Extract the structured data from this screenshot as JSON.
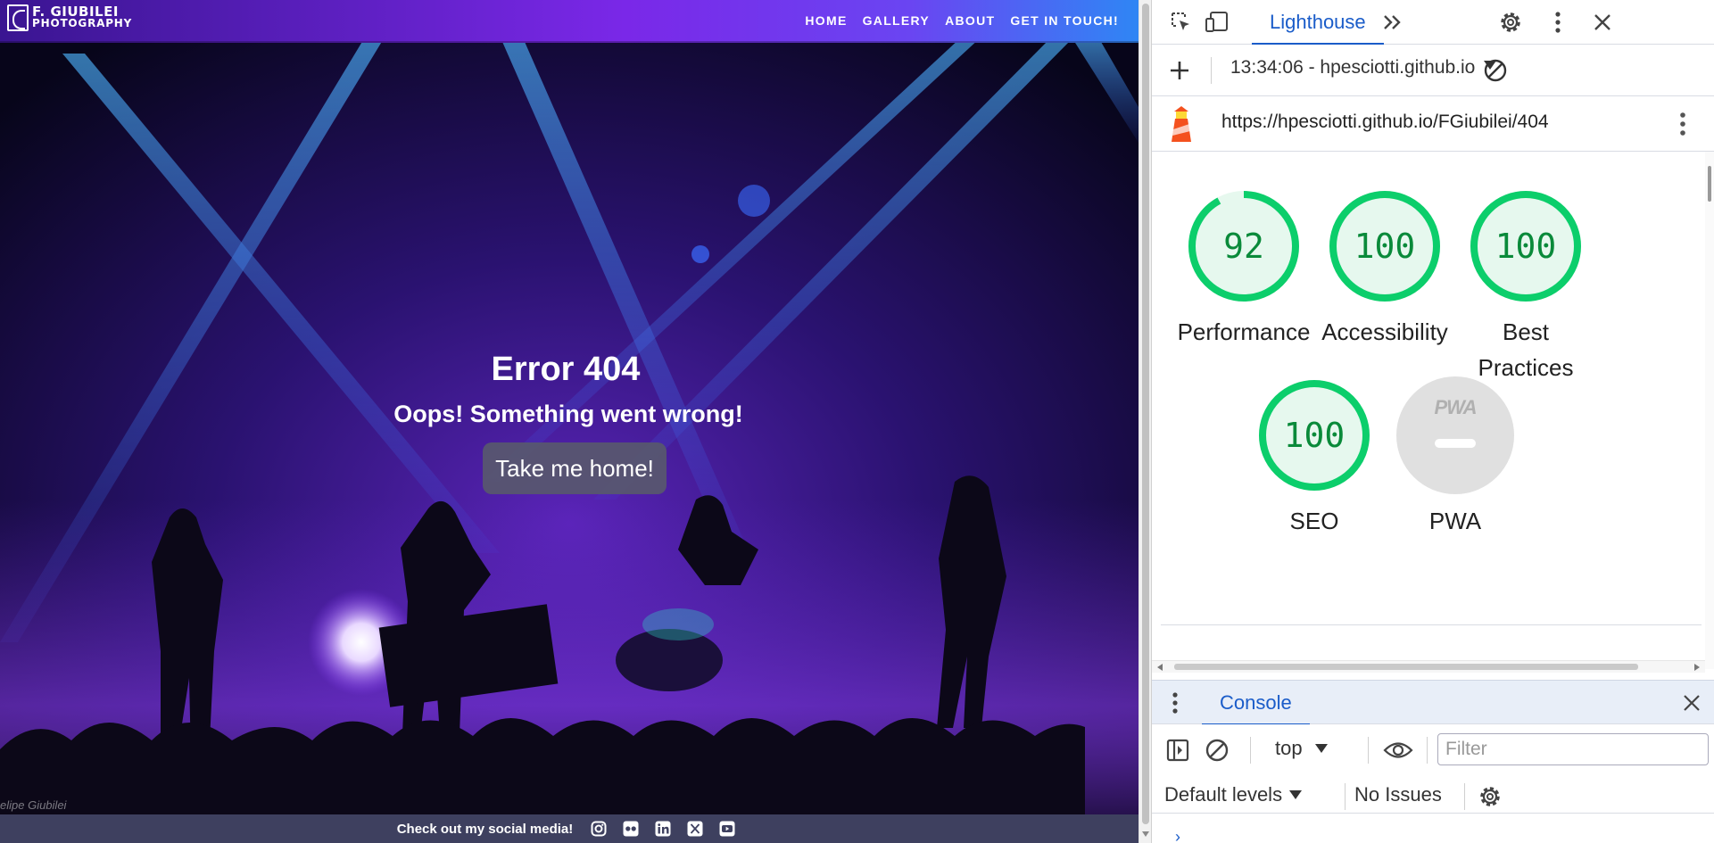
{
  "site": {
    "logo": {
      "line1": "F. GIUBILEI",
      "line2": "PHOTOGRAPHY"
    },
    "nav": [
      "HOME",
      "GALLERY",
      "ABOUT",
      "GET IN TOUCH!"
    ],
    "hero": {
      "title": "Error 404",
      "subtitle": "Oops! Something went wrong!",
      "button": "Take me home!"
    },
    "watermark": "elipe Giubilei",
    "footer": {
      "text": "Check out my social media!",
      "icons": [
        "instagram-icon",
        "flickr-icon",
        "linkedin-icon",
        "x-icon",
        "youtube-icon"
      ]
    }
  },
  "devtools": {
    "active_tab": "Lighthouse",
    "session": "13:34:06 - hpesciotti.github.io",
    "url": "https://hpesciotti.github.io/FGiubilei/404",
    "scores": [
      {
        "label": "Performance",
        "value": "92",
        "fraction": 0.92
      },
      {
        "label": "Accessibility",
        "value": "100",
        "fraction": 1.0
      },
      {
        "label": "Best Practices",
        "value": "100",
        "fraction": 1.0
      },
      {
        "label": "SEO",
        "value": "100",
        "fraction": 1.0
      }
    ],
    "pwa": {
      "label": "PWA",
      "badge": "PWA"
    },
    "drawer": {
      "tab": "Console",
      "context": "top",
      "filter_placeholder": "Filter",
      "levels": "Default levels",
      "issues": "No Issues"
    },
    "colors": {
      "pass": "#0cce6b",
      "pass_text": "#0a8a3a",
      "pass_fill": "#e6f8ee",
      "accent": "#1a5cc9"
    }
  }
}
